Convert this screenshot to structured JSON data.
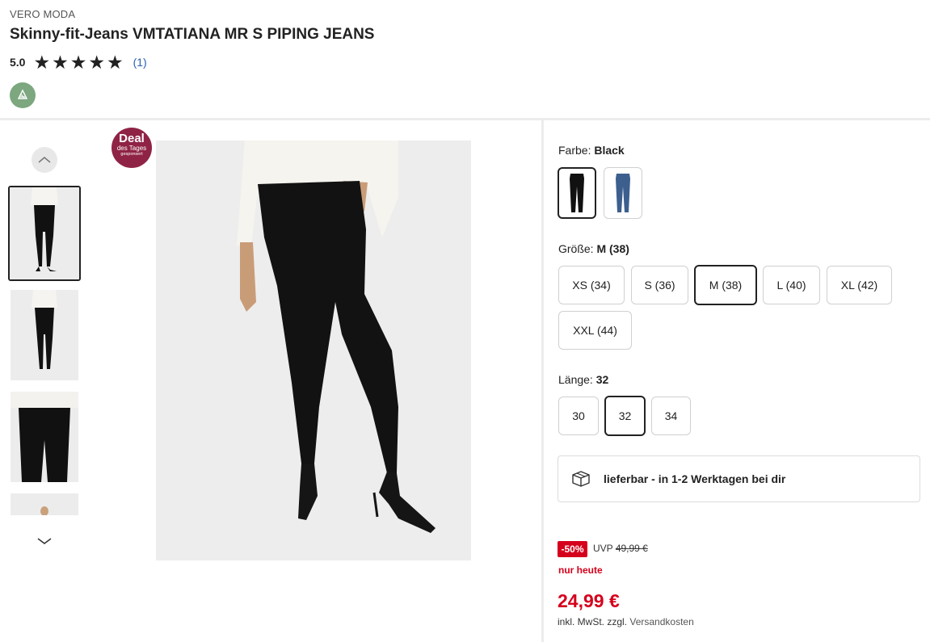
{
  "product": {
    "brand": "VERO MODA",
    "title": "Skinny-fit-Jeans VMTATIANA MR S PIPING JEANS",
    "rating": "5.0",
    "stars": 5,
    "review_count": "(1)"
  },
  "badges": {
    "deal_big": "Deal",
    "deal_small": "des Tages",
    "deal_tiny": "gesponsert"
  },
  "color": {
    "label": "Farbe:",
    "value": "Black",
    "swatches": [
      {
        "name": "Black",
        "color": "#111111",
        "selected": true
      },
      {
        "name": "Blue",
        "color": "#3c5f8e",
        "selected": false
      }
    ]
  },
  "size": {
    "label": "Größe:",
    "value": "M (38)",
    "options": [
      "XS (34)",
      "S (36)",
      "M (38)",
      "L (40)",
      "XL (42)",
      "XXL (44)"
    ],
    "selected": "M (38)"
  },
  "length": {
    "label": "Länge:",
    "value": "32",
    "options": [
      "30",
      "32",
      "34"
    ],
    "selected": "32"
  },
  "delivery": {
    "icon": "package-icon",
    "text": "lieferbar - in 1-2 Werktagen bei dir"
  },
  "price": {
    "discount": "-50%",
    "uvp_label": "UVP",
    "uvp_value": "49,99 €",
    "today": "nur heute",
    "current": "24,99 €",
    "vat_prefix": "inkl. MwSt. zzgl.",
    "vat_link": "Versandkosten"
  },
  "colors": {
    "sale_red": "#d5001c",
    "deal_badge": "#8f2346",
    "eco_badge": "#7ca77f",
    "link_blue": "#2b5fb4"
  }
}
